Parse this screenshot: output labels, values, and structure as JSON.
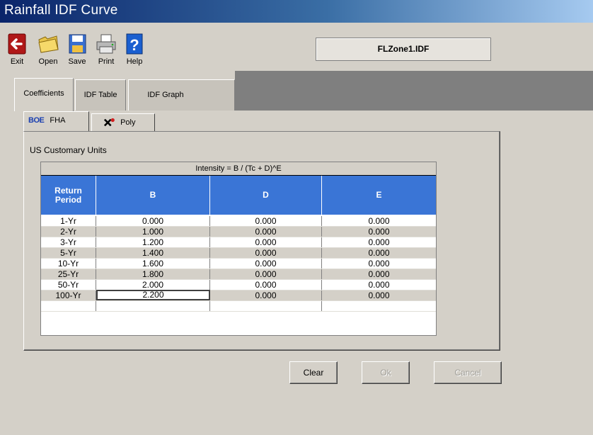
{
  "window": {
    "title": "Rainfall IDF Curve"
  },
  "toolbar": {
    "exit_label": "Exit",
    "open_label": "Open",
    "save_label": "Save",
    "print_label": "Print",
    "help_label": "Help",
    "file_name": "FLZone1.IDF"
  },
  "tabs": [
    "Coefficients",
    "IDF Table",
    "IDF Graph"
  ],
  "subtabs": {
    "fha_prefix": "BOE",
    "fha_label": "FHA",
    "poly_label": "Poly"
  },
  "units_label": "US Customary Units",
  "grid": {
    "formula": "Intensity = B / (Tc + D)^E",
    "headers": [
      "Return Period",
      "B",
      "D",
      "E"
    ],
    "rows": [
      [
        "1-Yr",
        "0.000",
        "0.000",
        "0.000"
      ],
      [
        "2-Yr",
        "1.000",
        "0.000",
        "0.000"
      ],
      [
        "3-Yr",
        "1.200",
        "0.000",
        "0.000"
      ],
      [
        "5-Yr",
        "1.400",
        "0.000",
        "0.000"
      ],
      [
        "10-Yr",
        "1.600",
        "0.000",
        "0.000"
      ],
      [
        "25-Yr",
        "1.800",
        "0.000",
        "0.000"
      ],
      [
        "50-Yr",
        "2.000",
        "0.000",
        "0.000"
      ],
      [
        "100-Yr",
        "2.200",
        "0.000",
        "0.000"
      ]
    ]
  },
  "buttons": {
    "clear": "Clear",
    "ok": "Ok",
    "cancel": "Cancel"
  },
  "colors": {
    "header_blue": "#3a75d6",
    "title_gradient_start": "#0a246a"
  }
}
